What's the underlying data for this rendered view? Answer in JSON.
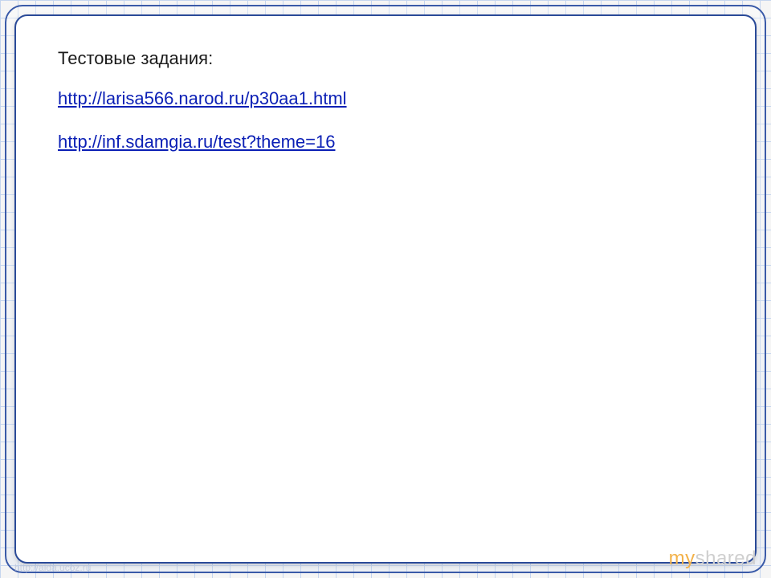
{
  "slide": {
    "heading": "Тестовые задания:",
    "links": [
      {
        "text": "http://larisa566.narod.ru/p30aa1.html"
      },
      {
        "text": "http://inf.sdamgia.ru/test?theme=16"
      }
    ]
  },
  "watermark": {
    "prefix": "my",
    "suffix": "shared"
  },
  "footer_url": "http://aida.ucoz.ru"
}
